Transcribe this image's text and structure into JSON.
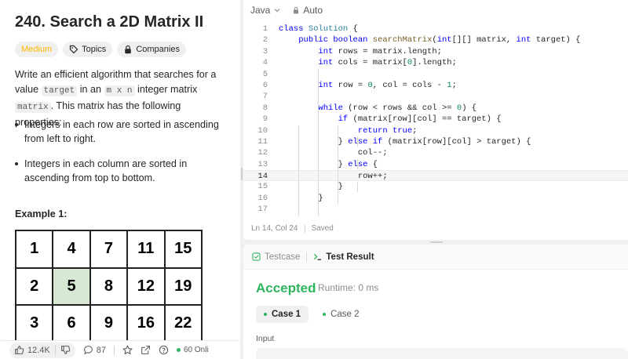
{
  "problem": {
    "title": "240. Search a 2D Matrix II",
    "difficulty": "Medium",
    "topics_label": "Topics",
    "companies_label": "Companies",
    "desc_1": "Write an efficient algorithm that searches for a value ",
    "code_target": "target",
    "desc_2": " in an ",
    "code_mxn": "m x n",
    "desc_3": " integer matrix ",
    "code_matrix": "matrix",
    "desc_4": ". This matrix has the following properties:",
    "properties": [
      "Integers in each row are sorted in ascending from left to right.",
      "Integers in each column are sorted in ascending from top to bottom."
    ],
    "example_label": "Example 1:",
    "matrix": [
      [
        "1",
        "4",
        "7",
        "11",
        "15"
      ],
      [
        "2",
        "5",
        "8",
        "12",
        "19"
      ],
      [
        "3",
        "6",
        "9",
        "16",
        "22"
      ]
    ],
    "highlight": {
      "row": 1,
      "col": 1
    }
  },
  "bottombar": {
    "likes": "12.4K",
    "comments": "87",
    "online": "60 Onli"
  },
  "editor": {
    "language": "Java",
    "mode": "Auto",
    "status_position": "Ln 14, Col 24",
    "status_saved": "Saved",
    "active_line": 14,
    "line_numbers": [
      "1",
      "2",
      "3",
      "4",
      "5",
      "6",
      "7",
      "8",
      "9",
      "10",
      "11",
      "12",
      "13",
      "14",
      "15",
      "16",
      "17"
    ]
  },
  "result": {
    "tab_testcase": "Testcase",
    "tab_result": "Test Result",
    "verdict": "Accepted",
    "runtime": "Runtime: 0 ms",
    "case1": "Case 1",
    "case2": "Case 2",
    "input_label": "Input"
  },
  "colors": {
    "accepted": "#2db55d",
    "medium": "#ffb800",
    "highlight_cell": "#d7e8d3"
  }
}
